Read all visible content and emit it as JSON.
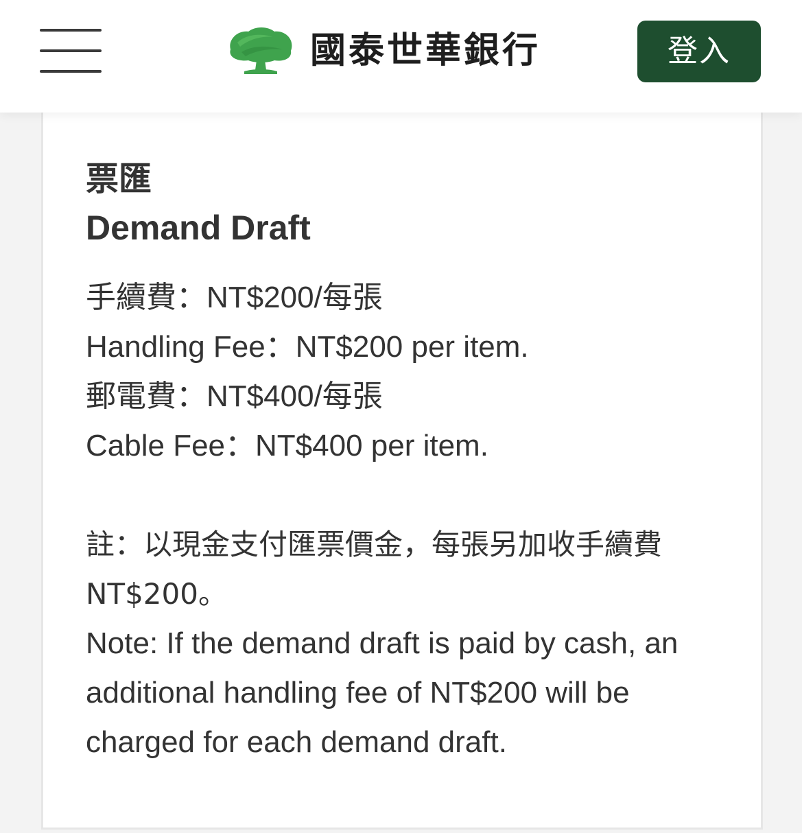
{
  "header": {
    "bank_name": "國泰世華銀行",
    "login_label": "登入",
    "brand_color": "#1e4e2f",
    "logo_color": "#3fa34d"
  },
  "card": {
    "title_zh": "票匯",
    "title_en": "Demand Draft",
    "fees": [
      "手續費：NT$200/每張",
      "Handling Fee：NT$200 per item.",
      "郵電費：NT$400/每張",
      "Cable Fee：NT$400 per item."
    ],
    "note_zh": "註：以現金支付匯票價金，每張另加收手續費NT$200。",
    "note_en": "Note: If the demand draft is paid by cash, an additional handling fee of NT$200 will be charged for each demand draft."
  }
}
